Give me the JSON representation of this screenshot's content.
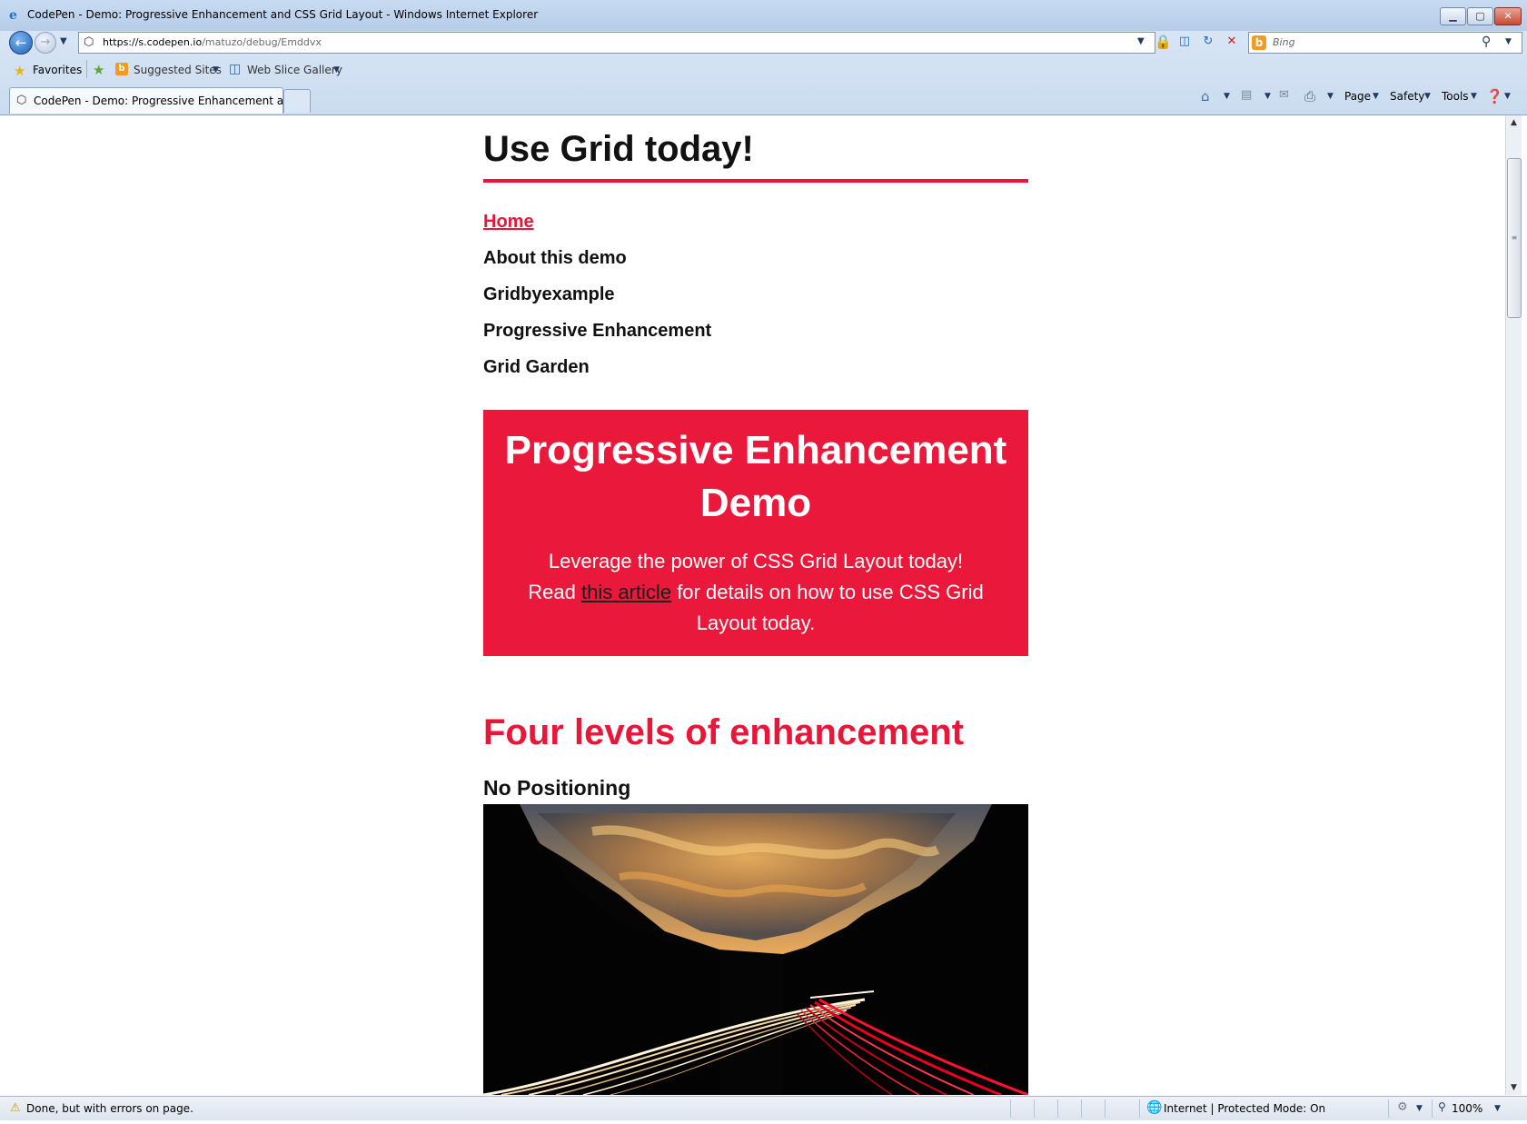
{
  "window": {
    "title": "CodePen - Demo: Progressive Enhancement and CSS Grid Layout - Windows Internet Explorer",
    "minimize": "▁",
    "maximize": "▢",
    "close": "✕"
  },
  "address": {
    "url_host": "https://s.codepen.io",
    "url_path": "/matuzo/debug/Emddvx"
  },
  "search": {
    "placeholder": "Bing"
  },
  "favorites_bar": {
    "favorites": "Favorites",
    "suggested_sites": "Suggested Sites",
    "web_slice_gallery": "Web Slice Gallery"
  },
  "tabs": [
    {
      "label": "CodePen - Demo: Progressive Enhancement and ..."
    }
  ],
  "command_bar": {
    "page": "Page",
    "safety": "Safety",
    "tools": "Tools"
  },
  "page": {
    "title": "Use Grid today!",
    "nav": [
      {
        "label": "Home",
        "active": true
      },
      {
        "label": "About this demo"
      },
      {
        "label": "Gridbyexample"
      },
      {
        "label": "Progressive Enhancement"
      },
      {
        "label": "Grid Garden"
      }
    ],
    "hero": {
      "title": "Progressive Enhancement Demo",
      "line1": "Leverage the power of CSS Grid Layout today!",
      "read": "Read",
      "link": "this article",
      "rest": "for details on how to use CSS Grid Layout today."
    },
    "section_heading": "Four levels of enhancement",
    "level_heading": "No Positioning"
  },
  "status": {
    "text": "Done, but with errors on page.",
    "zone": "Internet | Protected Mode: On",
    "zoom": "100%"
  },
  "colors": {
    "accent": "#e8173a",
    "hero_bg": "#ea183a"
  }
}
